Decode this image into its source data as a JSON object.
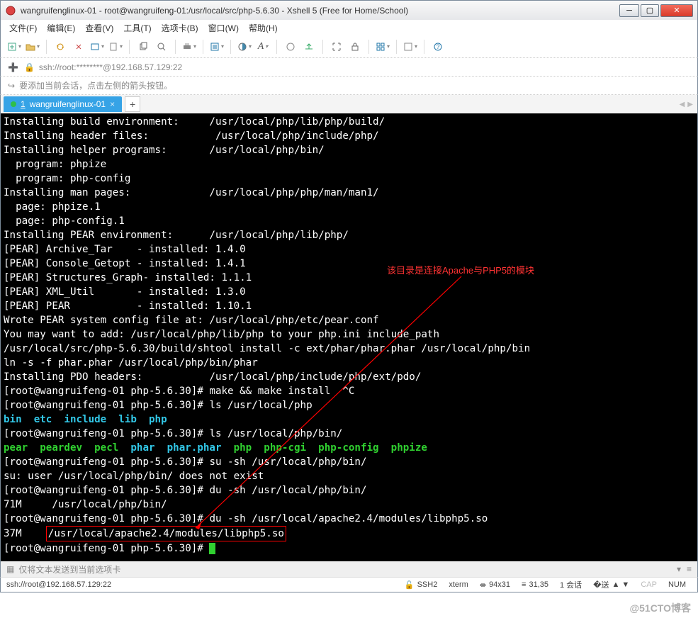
{
  "window": {
    "title": "wangruifenglinux-01 - root@wangruifeng-01:/usr/local/src/php-5.6.30 - Xshell 5 (Free for Home/School)"
  },
  "menu": {
    "file": "文件(F)",
    "edit": "编辑(E)",
    "view": "查看(V)",
    "tools": "工具(T)",
    "tab": "选项卡(B)",
    "window": "窗口(W)",
    "help": "帮助(H)"
  },
  "address": {
    "text": "ssh://root:********@192.168.57.129:22"
  },
  "hint": {
    "text": "要添加当前会话，点击左侧的箭头按钮。"
  },
  "tabs": {
    "items": [
      {
        "num": "1",
        "label": "wangruifenglinux-01"
      }
    ]
  },
  "annotation": {
    "text": "该目录是连接Apache与PHP5的模块"
  },
  "terminal": {
    "lines": [
      {
        "t": "Installing build environment:     /usr/local/php/lib/php/build/"
      },
      {
        "t": "Installing header files:           /usr/local/php/include/php/"
      },
      {
        "t": "Installing helper programs:       /usr/local/php/bin/"
      },
      {
        "t": "  program: phpize"
      },
      {
        "t": "  program: php-config"
      },
      {
        "t": "Installing man pages:             /usr/local/php/php/man/man1/"
      },
      {
        "t": "  page: phpize.1"
      },
      {
        "t": "  page: php-config.1"
      },
      {
        "t": "Installing PEAR environment:      /usr/local/php/lib/php/"
      },
      {
        "t": "[PEAR] Archive_Tar    - installed: 1.4.0"
      },
      {
        "t": "[PEAR] Console_Getopt - installed: 1.4.1"
      },
      {
        "t": "[PEAR] Structures_Graph- installed: 1.1.1"
      },
      {
        "t": "[PEAR] XML_Util       - installed: 1.3.0"
      },
      {
        "t": "[PEAR] PEAR           - installed: 1.10.1"
      },
      {
        "t": "Wrote PEAR system config file at: /usr/local/php/etc/pear.conf"
      },
      {
        "t": "You may want to add: /usr/local/php/lib/php to your php.ini include_path"
      },
      {
        "t": "/usr/local/src/php-5.6.30/build/shtool install -c ext/phar/phar.phar /usr/local/php/bin"
      },
      {
        "t": "ln -s -f phar.phar /usr/local/php/bin/phar"
      },
      {
        "t": "Installing PDO headers:           /usr/local/php/include/php/ext/pdo/"
      }
    ],
    "prompt_user": "root@wangruifeng-01",
    "prompt_dir": "php-5.6.30",
    "cmds": {
      "c1": "make && make install  ^C",
      "c2": "ls /usr/local/php",
      "c3": "ls /usr/local/php/bin/",
      "c4": "su -sh /usr/local/php/bin/",
      "c5": "du -sh /usr/local/php/bin/",
      "c6": "du -sh /usr/local/apache2.4/modules/libphp5.so"
    },
    "out_ls1": "bin  etc  include  lib  php",
    "out_ls2_g": "pear  peardev  pecl",
    "out_ls2_c": "  phar  phar.phar",
    "out_ls2_g2": "  php  php-cgi  php-config  phpize",
    "out_su": "su: user /usr/local/php/bin/ does not exist",
    "out_du1": "71M     /usr/local/php/bin/",
    "out_du2_size": "37M    ",
    "out_du2_path": "/usr/local/apache2.4/modules/libphp5.so"
  },
  "sendbar": {
    "text": "仅将文本发送到当前选项卡"
  },
  "status": {
    "conn": "ssh://root@192.168.57.129:22",
    "proto": "SSH2",
    "term": "xterm",
    "size": "94x31",
    "pos": "31,35",
    "sess": "1 会话",
    "cap": "CAP",
    "num": "NUM"
  },
  "watermark": "@51CTO博客"
}
